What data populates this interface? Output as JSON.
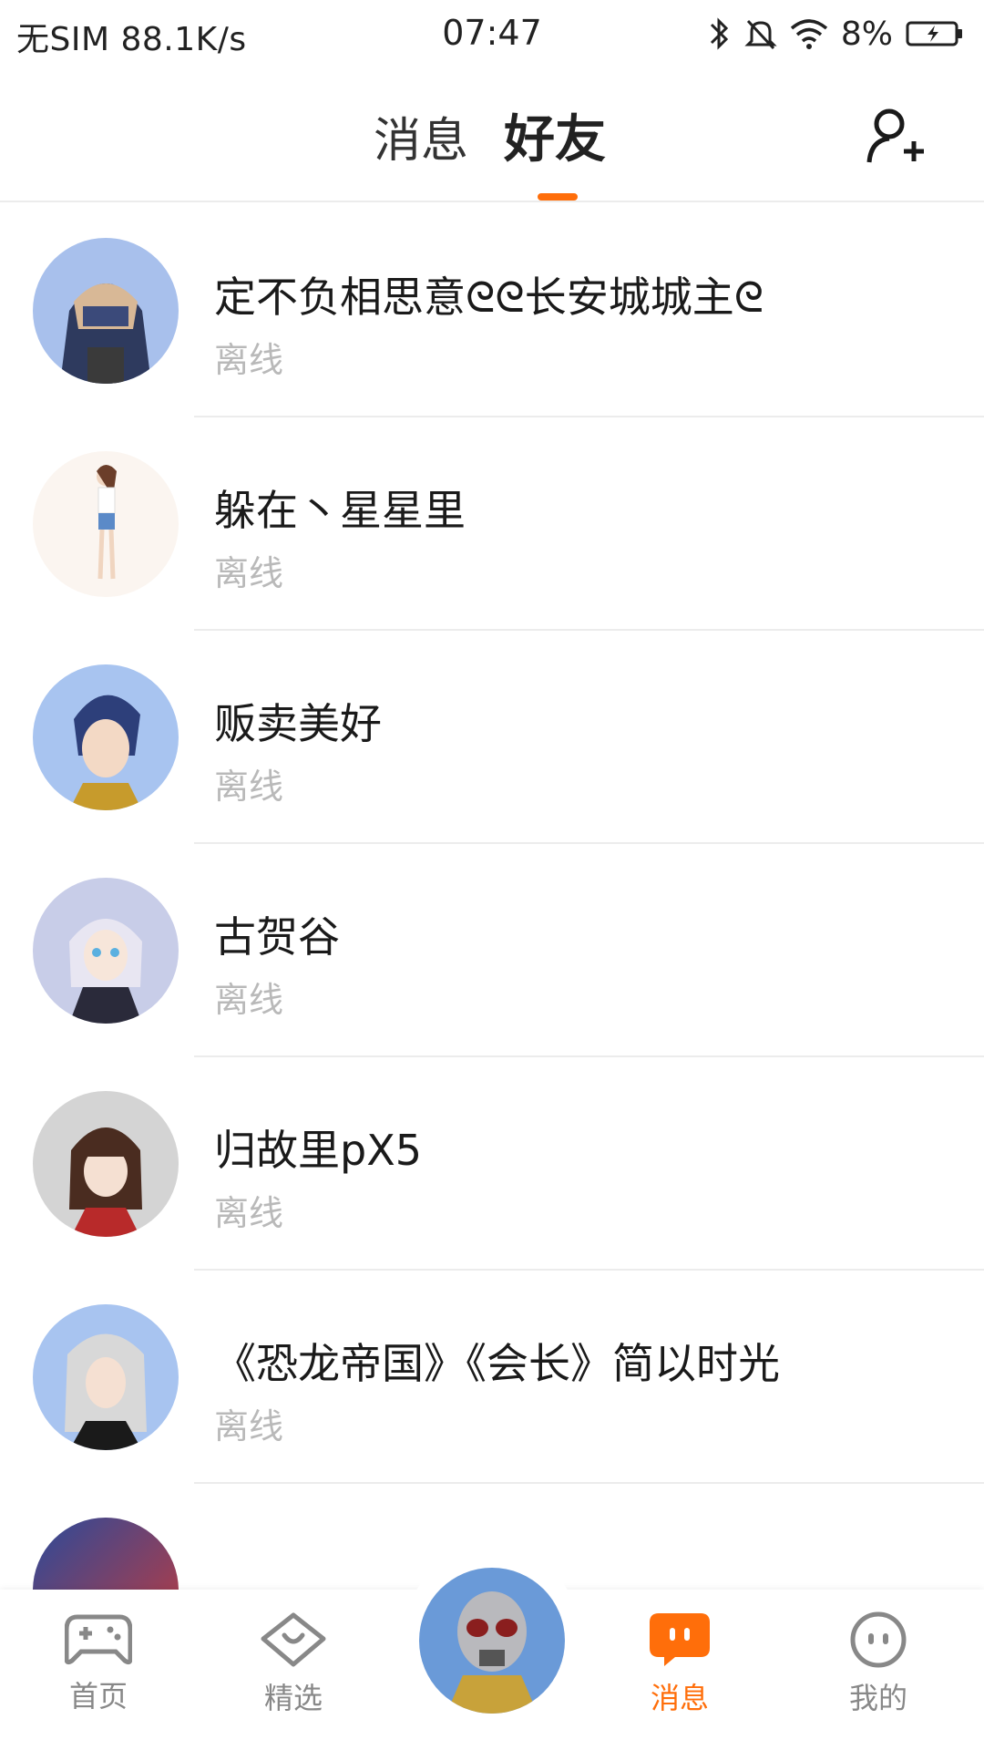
{
  "status_bar": {
    "carrier": "无SIM",
    "speed": "88.1K/s",
    "time": "07:47",
    "battery": "8%"
  },
  "header": {
    "tabs": [
      {
        "label": "消息",
        "active": false
      },
      {
        "label": "好友",
        "active": true
      }
    ],
    "accent_color": "#ff6e0a"
  },
  "friends": [
    {
      "name": "定不负相思意ᘓᘓ长安城城主ᘓ",
      "status": "离线"
    },
    {
      "name": "躲在丶星星里",
      "status": "离线"
    },
    {
      "name": "贩卖美好",
      "status": "离线"
    },
    {
      "name": "古贺谷",
      "status": "离线"
    },
    {
      "name": "归故里pX5",
      "status": "离线"
    },
    {
      "name": "《恐龙帝国》《会长》简以时光",
      "status": "离线"
    }
  ],
  "bottom_nav": [
    {
      "label": "首页",
      "icon": "gamepad-icon"
    },
    {
      "label": "精选",
      "icon": "heart-chat-icon"
    },
    {
      "label": "消息",
      "icon": "message-icon",
      "active": true
    },
    {
      "label": "我的",
      "icon": "smiley-icon"
    }
  ]
}
